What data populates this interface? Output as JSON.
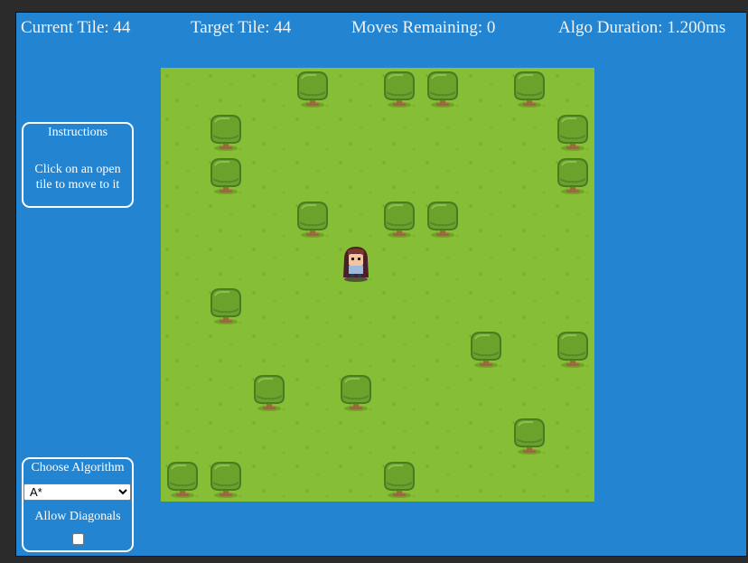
{
  "stats": {
    "current_tile": "Current Tile: 44",
    "target_tile": "Target Tile: 44",
    "moves_remaining": "Moves Remaining: 0",
    "algo_duration": "Algo Duration: 1.200ms"
  },
  "instructions": {
    "title": "Instructions",
    "body": "Click on an open tile to move to it"
  },
  "controls": {
    "algorithm_label": "Choose Algorithm",
    "algorithm_selected": "A*",
    "diagonals_label": "Allow Diagonals",
    "diagonals_checked": false
  },
  "board": {
    "columns": 10,
    "rows": 10,
    "trees": [
      3,
      5,
      6,
      8,
      11,
      19,
      21,
      29,
      33,
      35,
      36,
      51,
      67,
      69,
      72,
      74,
      88,
      90,
      91,
      95
    ],
    "player_tile": 44
  },
  "colors": {
    "background": "#2384d1",
    "grass": "#86bf36",
    "tree_foliage": "#6aa22c",
    "tree_trunk": "#9a6a3a"
  }
}
